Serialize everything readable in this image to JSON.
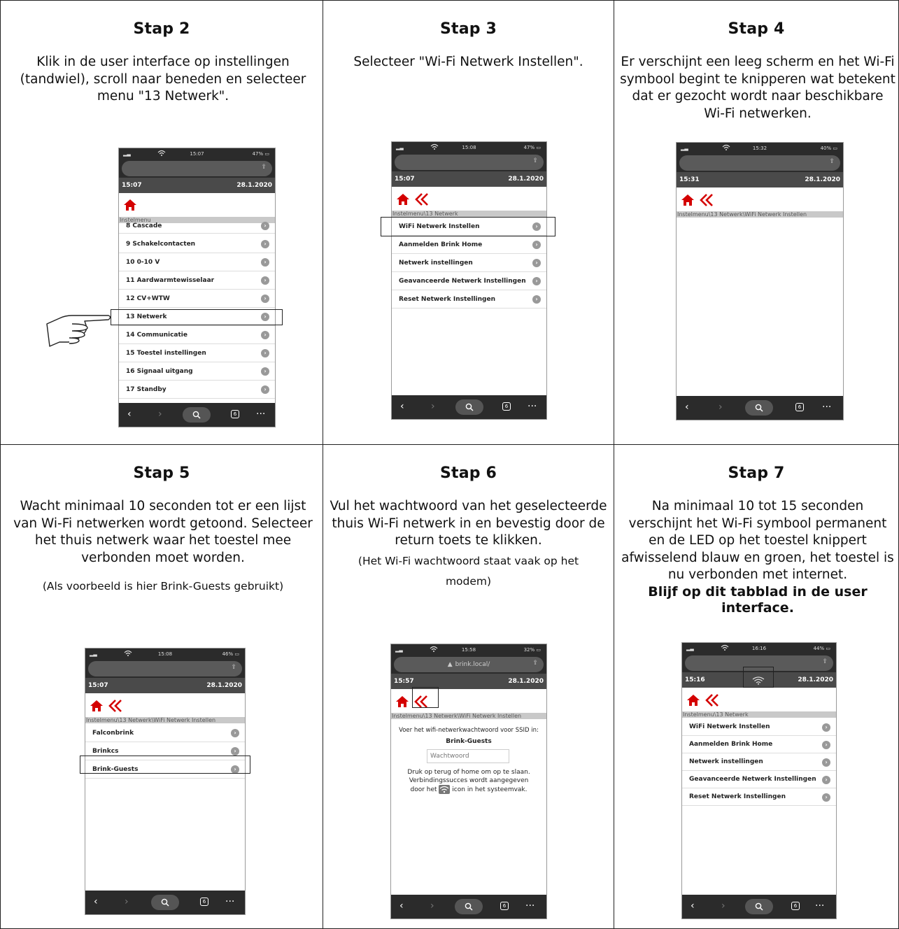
{
  "steps": [
    {
      "title": "Stap 2",
      "text": "Klik in de user interface op instellingen (tandwiel), scroll naar beneden en selecteer menu \"13 Netwerk\".",
      "phone": {
        "status_time": "15:07",
        "battery": "47%",
        "app_time": "15:07",
        "app_date": "28.1.2020",
        "breadcrumb": "Instelmenu",
        "items": [
          "8 Cascade",
          "9 Schakelcontacten",
          "10 0-10 V",
          "11 Aardwarmtewisselaar",
          "12 CV+WTW",
          "13 Netwerk",
          "14 Communicatie",
          "15 Toestel instellingen",
          "16 Signaal uitgang",
          "17 Standby"
        ]
      }
    },
    {
      "title": "Stap 3",
      "text": "Selecteer \"Wi-Fi Netwerk Instellen\".",
      "phone": {
        "status_time": "15:08",
        "battery": "47%",
        "app_time": "15:07",
        "app_date": "28.1.2020",
        "breadcrumb": "Instelmenu\\13 Netwerk",
        "items": [
          "WiFi Netwerk Instellen",
          "Aanmelden Brink Home",
          "Netwerk instellingen",
          "Geavanceerde Netwerk Instellingen",
          "Reset Netwerk Instellingen"
        ]
      }
    },
    {
      "title": "Stap 4",
      "text": "Er verschijnt een leeg scherm en het Wi-Fi symbool begint te knipperen wat betekent dat er gezocht wordt naar beschikbare Wi-Fi netwerken.",
      "phone": {
        "status_time": "15:32",
        "battery": "40%",
        "app_time": "15:31",
        "app_date": "28.1.2020",
        "breadcrumb": "Instelmenu\\13 Netwerk\\WiFi Netwerk Instellen",
        "items": []
      }
    },
    {
      "title": "Stap 5",
      "text": "Wacht minimaal 10 seconden tot er een lijst van Wi-Fi netwerken wordt getoond. Selecteer het thuis netwerk waar het toestel mee verbonden moet worden.",
      "note": "(Als voorbeeld is hier Brink-Guests gebruikt)",
      "phone": {
        "status_time": "15:08",
        "battery": "46%",
        "app_time": "15:07",
        "app_date": "28.1.2020",
        "breadcrumb": "Instelmenu\\13 Netwerk\\WiFi Netwerk Instellen",
        "items": [
          "Falconbrink",
          "Brinkcs",
          "Brink-Guests"
        ]
      }
    },
    {
      "title": "Stap 6",
      "text": "Vul het wachtwoord van het geselecteerde thuis Wi-Fi netwerk in en bevestig door de return toets te klikken.",
      "note": "(Het Wi-Fi wachtwoord staat vaak op het modem)",
      "phone": {
        "status_time": "15:58",
        "battery": "32%",
        "url": "brink.local/",
        "app_time": "15:57",
        "app_date": "28.1.2020",
        "breadcrumb": "Instelmenu\\13 Netwerk\\WiFi Netwerk Instellen",
        "prompt": "Voer het wifi-netwerkwachtwoord voor SSID in:",
        "ssid": "Brink-Guests",
        "password_placeholder": "Wachtwoord",
        "info_1": "Druk op terug of home om op te slaan.",
        "info_2": "Verbindingssucces wordt aangegeven",
        "info_3a": "door het",
        "info_3b": "icon in het systeemvak."
      }
    },
    {
      "title": "Stap 7",
      "text": "Na minimaal 10 tot 15 seconden verschijnt het Wi-Fi symbool permanent en de LED op het toestel knippert afwisselend blauw en groen, het toestel is nu verbonden met internet.",
      "bold_note": "Blijf op dit tabblad in de user interface.",
      "phone": {
        "status_time": "16:16",
        "battery": "44%",
        "app_time": "15:16",
        "app_date": "28.1.2020",
        "breadcrumb": "Instelmenu\\13 Netwerk",
        "items": [
          "WiFi Netwerk Instellen",
          "Aanmelden Brink Home",
          "Netwerk instellingen",
          "Geavanceerde Netwerk Instellingen",
          "Reset Netwerk Instellingen"
        ]
      }
    }
  ],
  "ui": {
    "tab_count": "6",
    "accent": "#d40000"
  }
}
